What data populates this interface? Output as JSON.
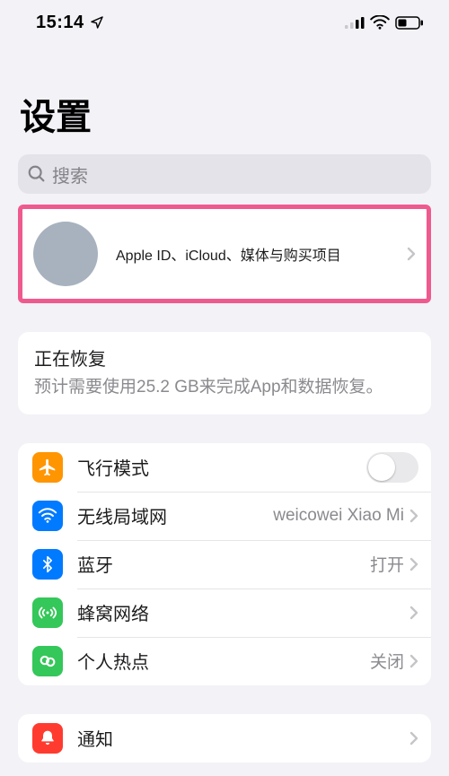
{
  "status": {
    "time": "15:14"
  },
  "title": "设置",
  "search": {
    "placeholder": "搜索"
  },
  "appleid": {
    "subtitle": "Apple ID、iCloud、媒体与购买项目"
  },
  "restoring": {
    "title": "正在恢复",
    "subtitle": "预计需要使用25.2 GB来完成App和数据恢复。"
  },
  "rows": {
    "airplane": {
      "label": "飞行模式",
      "on": false
    },
    "wifi": {
      "label": "无线局域网",
      "value": "weicowei Xiao Mi"
    },
    "bt": {
      "label": "蓝牙",
      "value": "打开"
    },
    "cellular": {
      "label": "蜂窝网络",
      "value": ""
    },
    "hotspot": {
      "label": "个人热点",
      "value": "关闭"
    },
    "notif": {
      "label": "通知"
    }
  },
  "colors": {
    "highlight": "#ef5a8e",
    "airplane": "#ff9500",
    "wifi": "#007aff",
    "bt": "#007aff",
    "cellular": "#34c759",
    "hotspot": "#34c759",
    "notif": "#ff3b30"
  }
}
